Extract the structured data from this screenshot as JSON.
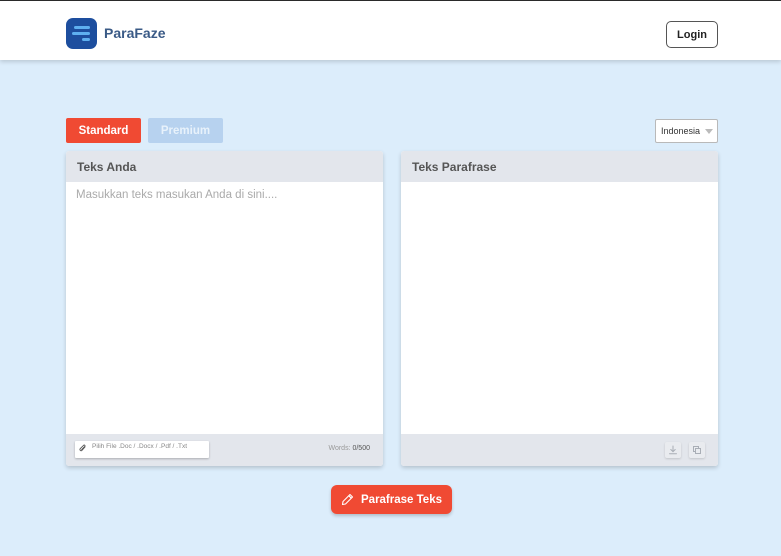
{
  "header": {
    "brand": "ParaFaze",
    "logo_icon": "menu-lines-logo",
    "login_label": "Login"
  },
  "modes": {
    "standard_label": "Standard",
    "premium_label": "Premium",
    "active": "Standard"
  },
  "language": {
    "selected": "Indonesia"
  },
  "input_panel": {
    "title": "Teks Anda",
    "placeholder": "Masukkan teks masukan Anda di sini....",
    "value": "",
    "file_button_label": "Pilih File .Doc / .Docx / .Pdf / .Txt",
    "file_icon": "paperclip-icon",
    "words_label": "Words:",
    "words_count": "0/500"
  },
  "output_panel": {
    "title": "Teks Parafrase",
    "download_icon": "download-icon",
    "copy_icon": "copy-icon"
  },
  "action": {
    "paraphrase_label": "Parafrase Teks",
    "icon": "pencil-icon"
  },
  "colors": {
    "accent": "#f04a33",
    "premium": "#b7d2ef",
    "background": "#dcedfb",
    "brand_text": "#3a5a86",
    "logo_bg": "#1d4e9e"
  }
}
